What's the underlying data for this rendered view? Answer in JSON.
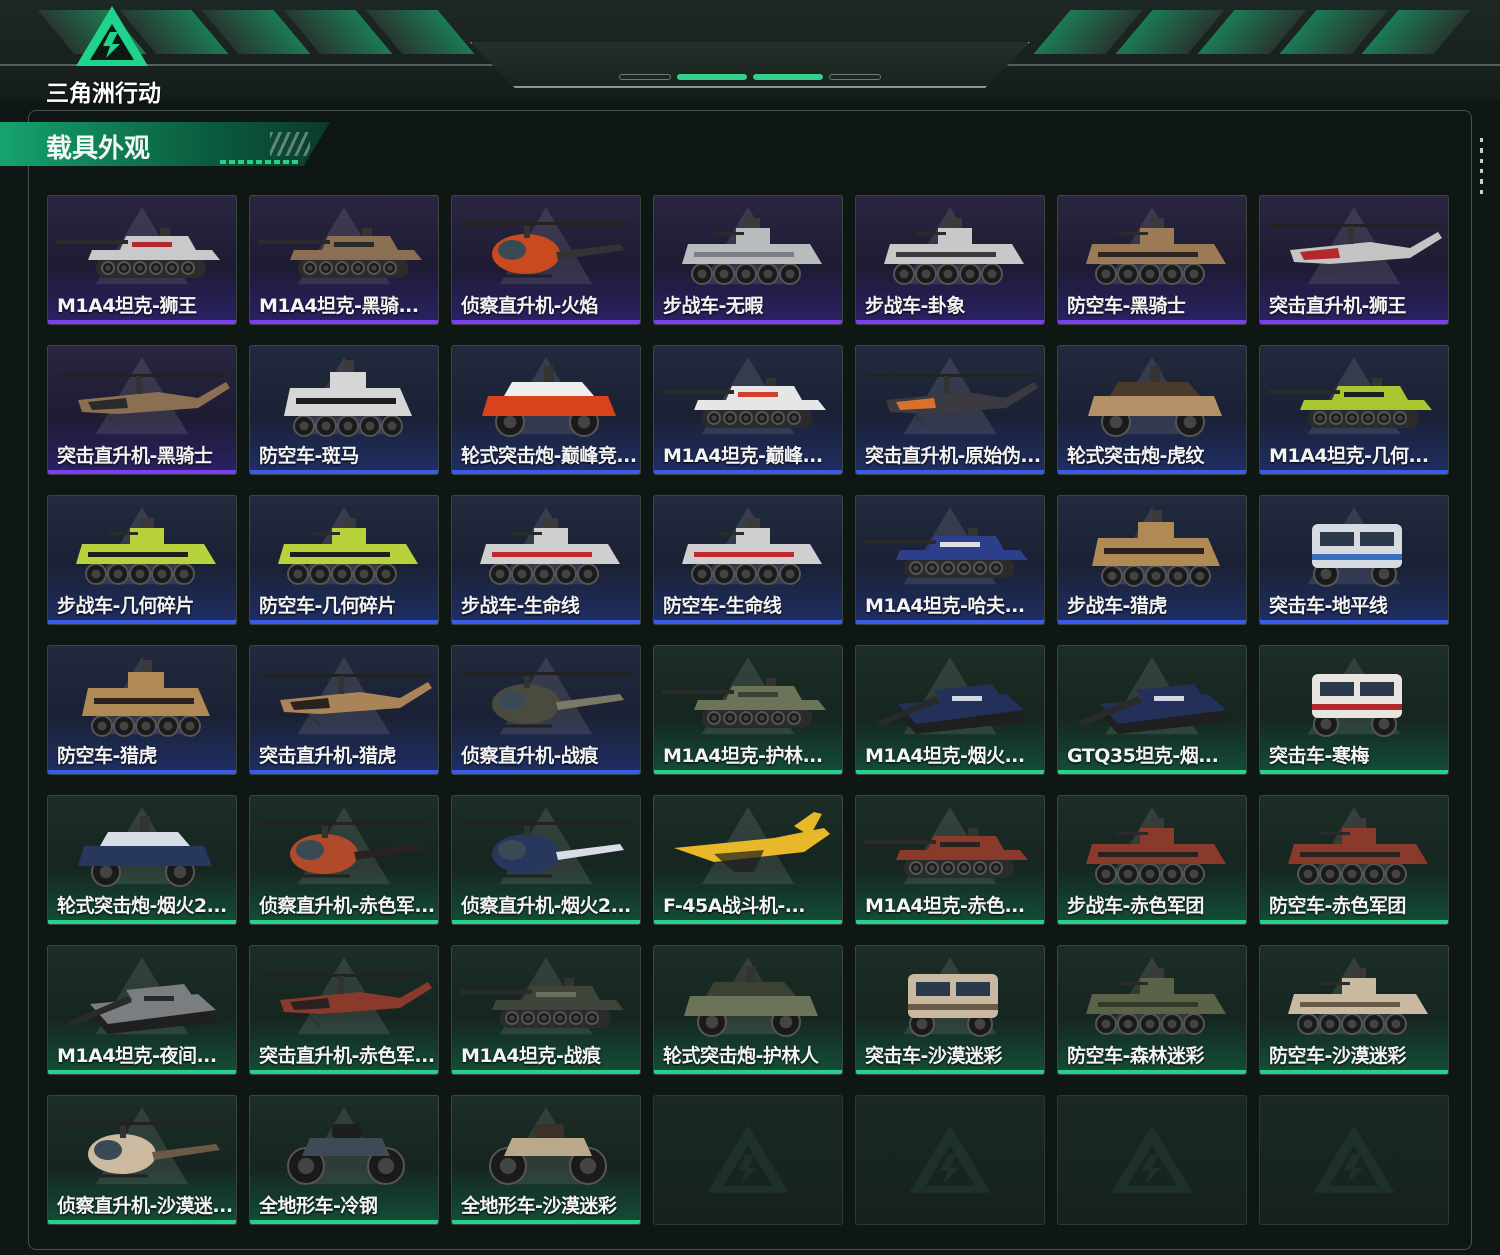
{
  "header": {
    "logo_text": "三角洲行动"
  },
  "section": {
    "title": "载具外观"
  },
  "colors": {
    "accent": "#27d189",
    "purple": "#7b3ef0",
    "blue": "#3a5be8",
    "green": "#27d189"
  },
  "vehicles": [
    {
      "name": "M1A4坦克-狮王",
      "rarity": "purple",
      "kind": "tank",
      "color": "#c9c9c9",
      "alt": "#b3282d"
    },
    {
      "name": "M1A4坦克-黑骑...",
      "rarity": "purple",
      "kind": "tank",
      "color": "#8a6f52",
      "alt": "#2a2a2a"
    },
    {
      "name": "侦察直升机-火焰",
      "rarity": "purple",
      "kind": "heli-small",
      "color": "#c94a1e",
      "alt": "#333"
    },
    {
      "name": "步战车-无暇",
      "rarity": "purple",
      "kind": "apc",
      "color": "#b9bcbd",
      "alt": "#7b7f82"
    },
    {
      "name": "步战车-卦象",
      "rarity": "purple",
      "kind": "apc",
      "color": "#c8c8c8",
      "alt": "#3b3b3b"
    },
    {
      "name": "防空车-黑骑士",
      "rarity": "purple",
      "kind": "apc",
      "color": "#9c7a55",
      "alt": "#2d2620"
    },
    {
      "name": "突击直升机-狮王",
      "rarity": "purple",
      "kind": "heli-attack",
      "color": "#c4c4c4",
      "alt": "#b3282d"
    },
    {
      "name": "突击直升机-黑骑士",
      "rarity": "purple",
      "kind": "heli-attack",
      "color": "#8a6f52",
      "alt": "#2a2a2a"
    },
    {
      "name": "防空车-斑马",
      "rarity": "blue",
      "kind": "apc-tall",
      "color": "#d6d6d6",
      "alt": "#1e1e1e"
    },
    {
      "name": "轮式突击炮-巅峰竞...",
      "rarity": "blue",
      "kind": "buggy",
      "color": "#d8431e",
      "alt": "#eeeeee"
    },
    {
      "name": "M1A4坦克-巅峰...",
      "rarity": "blue",
      "kind": "tank",
      "color": "#e6e6e6",
      "alt": "#d0402a"
    },
    {
      "name": "突击直升机-原始伪...",
      "rarity": "blue",
      "kind": "heli-attack",
      "color": "#3a3a40",
      "alt": "#d8702e"
    },
    {
      "name": "轮式突击炮-虎纹",
      "rarity": "blue",
      "kind": "buggy",
      "color": "#b39066",
      "alt": "#4a3a2a"
    },
    {
      "name": "M1A4坦克-几何...",
      "rarity": "blue",
      "kind": "tank",
      "color": "#a9c52f",
      "alt": "#1e1e1e"
    },
    {
      "name": "步战车-几何碎片",
      "rarity": "blue",
      "kind": "apc",
      "color": "#b7d23a",
      "alt": "#1e1e1e"
    },
    {
      "name": "防空车-几何碎片",
      "rarity": "blue",
      "kind": "apc",
      "color": "#b7d23a",
      "alt": "#1e1e1e"
    },
    {
      "name": "步战车-生命线",
      "rarity": "blue",
      "kind": "apc",
      "color": "#cfcfcf",
      "alt": "#c0282d"
    },
    {
      "name": "防空车-生命线",
      "rarity": "blue",
      "kind": "apc",
      "color": "#cfcfcf",
      "alt": "#c0282d"
    },
    {
      "name": "M1A4坦克-哈夫...",
      "rarity": "blue",
      "kind": "tank",
      "color": "#2d3f8a",
      "alt": "#e0e0e0"
    },
    {
      "name": "步战车-猎虎",
      "rarity": "blue",
      "kind": "apc-tall",
      "color": "#b08a55",
      "alt": "#2a2220"
    },
    {
      "name": "突击车-地平线",
      "rarity": "blue",
      "kind": "truck",
      "color": "#d5dbe0",
      "alt": "#3a70c0"
    },
    {
      "name": "防空车-猎虎",
      "rarity": "blue",
      "kind": "apc-tall",
      "color": "#b08a55",
      "alt": "#2a2220"
    },
    {
      "name": "突击直升机-猎虎",
      "rarity": "blue",
      "kind": "heli-attack",
      "color": "#a88458",
      "alt": "#2a2220"
    },
    {
      "name": "侦察直升机-战痕",
      "rarity": "blue",
      "kind": "heli-small",
      "color": "#4a4a3e",
      "alt": "#7d7a64"
    },
    {
      "name": "M1A4坦克-护林...",
      "rarity": "green",
      "kind": "tank",
      "color": "#6b7358",
      "alt": "#3c4233"
    },
    {
      "name": "M1A4坦克-烟火...",
      "rarity": "green",
      "kind": "tank-angle",
      "color": "#22305a",
      "alt": "#d0d6e6"
    },
    {
      "name": "GTQ35坦克-烟...",
      "rarity": "green",
      "kind": "tank-angle",
      "color": "#22305a",
      "alt": "#d0d6e6"
    },
    {
      "name": "突击车-寒梅",
      "rarity": "green",
      "kind": "truck",
      "color": "#e8e4e0",
      "alt": "#b3282d"
    },
    {
      "name": "轮式突击炮-烟火2...",
      "rarity": "green",
      "kind": "buggy",
      "color": "#27375e",
      "alt": "#d8dde8"
    },
    {
      "name": "侦察直升机-赤色军...",
      "rarity": "green",
      "kind": "heli-small",
      "color": "#b04a2a",
      "alt": "#2a2220"
    },
    {
      "name": "侦察直升机-烟火2...",
      "rarity": "green",
      "kind": "heli-small",
      "color": "#27375e",
      "alt": "#d8dde8"
    },
    {
      "name": "F-45A战斗机-...",
      "rarity": "green",
      "kind": "jet",
      "color": "#e8b828",
      "alt": "#1e1e1e"
    },
    {
      "name": "M1A4坦克-赤色...",
      "rarity": "green",
      "kind": "tank",
      "color": "#8a3a2a",
      "alt": "#2a2220"
    },
    {
      "name": "步战车-赤色军团",
      "rarity": "green",
      "kind": "apc",
      "color": "#8a3a2a",
      "alt": "#2a2220"
    },
    {
      "name": "防空车-赤色军团",
      "rarity": "green",
      "kind": "apc",
      "color": "#8a3a2a",
      "alt": "#2a2220"
    },
    {
      "name": "M1A4坦克-夜间...",
      "rarity": "green",
      "kind": "tank-angle",
      "color": "#7a7e80",
      "alt": "#2a2a2a"
    },
    {
      "name": "突击直升机-赤色军...",
      "rarity": "green",
      "kind": "heli-attack",
      "color": "#8a3a2a",
      "alt": "#2a2220"
    },
    {
      "name": "M1A4坦克-战痕",
      "rarity": "green",
      "kind": "tank",
      "color": "#3e443a",
      "alt": "#6a6e5e"
    },
    {
      "name": "轮式突击炮-护林人",
      "rarity": "green",
      "kind": "buggy",
      "color": "#6b7358",
      "alt": "#3c4233"
    },
    {
      "name": "突击车-沙漠迷彩",
      "rarity": "green",
      "kind": "truck",
      "color": "#c9b9a0",
      "alt": "#6a5a48"
    },
    {
      "name": "防空车-森林迷彩",
      "rarity": "green",
      "kind": "apc",
      "color": "#5a6248",
      "alt": "#343a2a"
    },
    {
      "name": "防空车-沙漠迷彩",
      "rarity": "green",
      "kind": "apc",
      "color": "#c9b9a0",
      "alt": "#6a5a48"
    },
    {
      "name": "侦察直升机-沙漠迷...",
      "rarity": "green",
      "kind": "heli-small",
      "color": "#cbb9a0",
      "alt": "#6a5a48"
    },
    {
      "name": "全地形车-冷钢",
      "rarity": "green",
      "kind": "atv",
      "color": "#3e4a56",
      "alt": "#1e1e1e"
    },
    {
      "name": "全地形车-沙漠迷彩",
      "rarity": "green",
      "kind": "atv",
      "color": "#b9a88a",
      "alt": "#3a3228"
    },
    {
      "name": "",
      "rarity": "empty",
      "kind": "empty"
    },
    {
      "name": "",
      "rarity": "empty",
      "kind": "empty"
    },
    {
      "name": "",
      "rarity": "empty",
      "kind": "empty"
    },
    {
      "name": "",
      "rarity": "empty",
      "kind": "empty"
    }
  ]
}
